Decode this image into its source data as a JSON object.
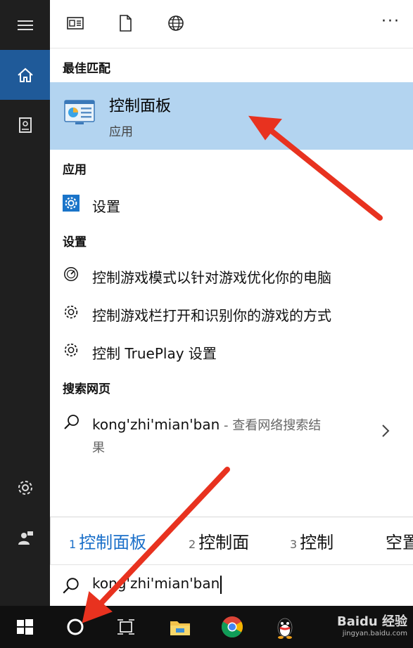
{
  "topbar": {
    "icons": [
      "document-layout-icon",
      "blank-page-icon",
      "globe-icon"
    ],
    "more_label": "···"
  },
  "rail": {
    "items": [
      "home-icon",
      "notebook-icon",
      "gear-icon",
      "user-feedback-icon"
    ]
  },
  "best_match": {
    "header": "最佳匹配",
    "title": "控制面板",
    "subtitle": "应用"
  },
  "apps": {
    "header": "应用",
    "items": [
      {
        "label": "设置"
      }
    ]
  },
  "settings": {
    "header": "设置",
    "items": [
      {
        "label": "控制游戏模式以针对游戏优化你的电脑"
      },
      {
        "label": "控制游戏栏打开和识别你的游戏的方式"
      },
      {
        "label": "控制 TruePlay 设置"
      }
    ]
  },
  "web": {
    "header": "搜索网页",
    "query": "kong'zhi'mian'ban",
    "suffix": " - 查看网络搜索结",
    "suffix_line2": "果"
  },
  "ime": {
    "candidates": [
      {
        "num": "1",
        "word": "控制面板"
      },
      {
        "num": "2",
        "word": "控制面"
      },
      {
        "num": "3",
        "word": "控制"
      },
      {
        "num": "",
        "word": "空置"
      }
    ]
  },
  "search": {
    "value": "kong'zhi'mian'ban"
  },
  "taskbar": {
    "items": [
      "windows-start-icon",
      "cortana-search-icon",
      "task-view-icon",
      "file-explorer-icon",
      "chrome-icon",
      "qq-icon"
    ]
  },
  "watermark": {
    "brand": "Baidu 经验",
    "url": "jingyan.baidu.com"
  },
  "colors": {
    "accent": "#1f5a99",
    "highlight": "#b3d4f0",
    "arrow": "#e8321f"
  }
}
